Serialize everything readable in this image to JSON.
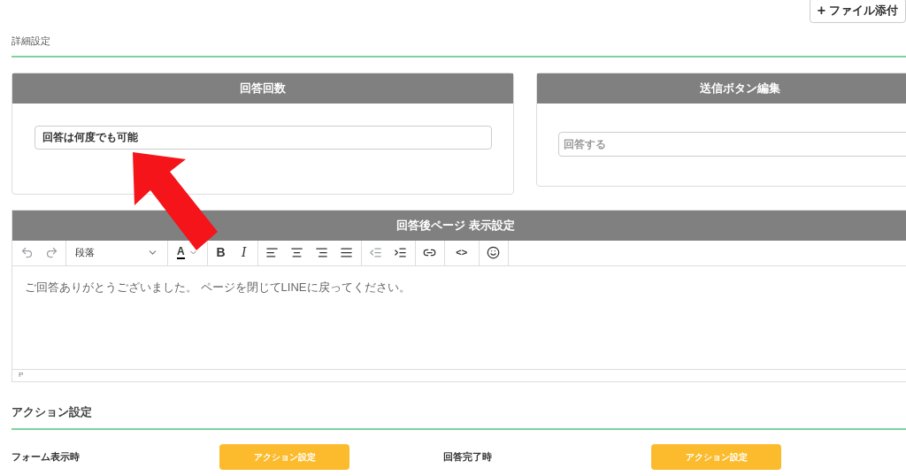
{
  "attach_button": {
    "icon": "+",
    "label": "ファイル添付"
  },
  "detail_heading": "詳細設定",
  "panels": [
    {
      "title": "回答回数",
      "field": {
        "kind": "select",
        "value": "回答は何度でも可能"
      }
    },
    {
      "title": "送信ボタン編集",
      "field": {
        "kind": "input",
        "placeholder": "回答する"
      }
    }
  ],
  "editor": {
    "title": "回答後ページ 表示設定",
    "toolbar": [
      [
        {
          "kind": "undo",
          "disabled": true
        },
        {
          "kind": "redo",
          "disabled": true
        }
      ],
      [
        {
          "kind": "block-select",
          "label": "段落"
        }
      ],
      [
        {
          "kind": "text-color",
          "label": "A"
        }
      ],
      [
        {
          "kind": "bold",
          "label": "B"
        },
        {
          "kind": "italic",
          "label": "I"
        }
      ],
      [
        {
          "kind": "align-left"
        },
        {
          "kind": "align-center"
        },
        {
          "kind": "align-right"
        },
        {
          "kind": "justify"
        }
      ],
      [
        {
          "kind": "outdent",
          "disabled": true
        },
        {
          "kind": "indent",
          "disabled": false
        }
      ],
      [
        {
          "kind": "link"
        }
      ],
      [
        {
          "kind": "code",
          "label": "<>"
        }
      ],
      [
        {
          "kind": "emoji"
        }
      ]
    ],
    "content": "ご回答ありがとうございました。 ページを閉じてLINEに戻ってください。",
    "status": "P"
  },
  "action_heading": "アクション設定",
  "actions": [
    {
      "label": "フォーム表示時",
      "button": "アクション設定"
    },
    {
      "label": "回答完了時",
      "button": "アクション設定"
    }
  ]
}
